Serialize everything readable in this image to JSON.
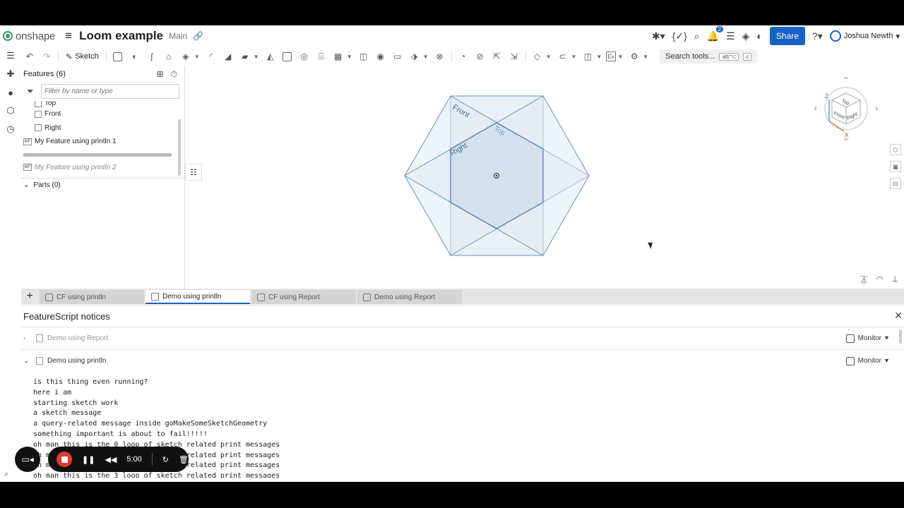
{
  "header": {
    "logo_text": "onshape",
    "doc_title": "Loom example",
    "branch": "Main",
    "notifications_count": "2",
    "share_label": "Share",
    "user_name": "Joshua Newth"
  },
  "toolbar": {
    "sketch_label": "Sketch",
    "search_label": "Search tools...",
    "shortcut_key1": "alt/⌥",
    "shortcut_key2": "c",
    "ex_label": "Ex"
  },
  "features": {
    "title": "Features (6)",
    "filter_placeholder": "Filter by name or type",
    "planes": [
      "Top",
      "Front",
      "Right"
    ],
    "custom_1": "My Feature using println 1",
    "custom_2": "My Feature using println 2",
    "mf_icon": "MF",
    "parts_label": "Parts (0)"
  },
  "viewport": {
    "plane_labels": {
      "front": "Front",
      "top": "Top",
      "right": "Right"
    },
    "cube_faces": {
      "top": "Top",
      "front": "Front",
      "right": "Right"
    },
    "axes": {
      "z": "Z",
      "x": "X"
    }
  },
  "tabs": [
    {
      "label": "CF using println",
      "active": false
    },
    {
      "label": "Demo using println",
      "active": true
    },
    {
      "label": "CF using Report",
      "active": false
    },
    {
      "label": "Demo using Report",
      "active": false
    }
  ],
  "notices": {
    "title": "FeatureScript notices",
    "rows": [
      {
        "name": "Demo using Report",
        "monitor": "Monitor"
      },
      {
        "name": "Demo using println",
        "monitor": "Monitor"
      }
    ],
    "console_lines": [
      "is this thing even running?",
      "here i am",
      "starting sketch work",
      "a sketch message",
      "a query-related message inside goMakeSomeSketchGeometry",
      "something important is about to fail!!!!!",
      "oh man this is the 0 loop of sketch related print messages",
      "oh man this is the 1 loop of sketch related print messages",
      "oh man this is the 2 loop of sketch related print messages",
      "oh man this is the 3 loop of sketch related print messages"
    ]
  },
  "recorder": {
    "time": "5:00"
  },
  "colors": {
    "accent": "#1762c5",
    "plane_fill": "#dfe9f3",
    "plane_stroke": "#6b93b8",
    "record": "#e53935"
  }
}
